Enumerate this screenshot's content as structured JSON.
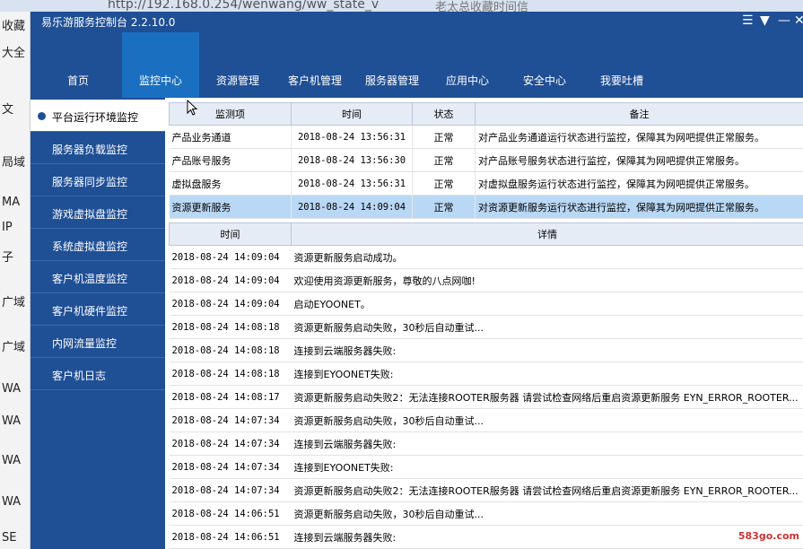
{
  "browser": {
    "url": "http://192.168.0.254/wenwang/ww_state_v",
    "tab_text": "老太总收藏时间信",
    "left_bits": [
      "收藏",
      "大全",
      "文",
      "局域",
      "MA",
      "IP",
      "子",
      "广域",
      "广域",
      "WA",
      "WA",
      "WA",
      "WA",
      "SE"
    ]
  },
  "window": {
    "title": "易乐游服务控制台 2.2.10.0",
    "controls": [
      "☰",
      "▼",
      "—",
      "✕"
    ]
  },
  "nav": [
    {
      "label": "首页",
      "icon": "home-icon"
    },
    {
      "label": "监控中心",
      "icon": "eye-icon"
    },
    {
      "label": "资源管理",
      "icon": "gamepad-icon"
    },
    {
      "label": "客户机管理",
      "icon": "monitor-icon"
    },
    {
      "label": "服务器管理",
      "icon": "server-icon"
    },
    {
      "label": "应用中心",
      "icon": "toolbox-icon"
    },
    {
      "label": "安全中心",
      "icon": "shield-icon"
    },
    {
      "label": "我要吐槽",
      "icon": "chat-icon"
    }
  ],
  "sidebar": [
    "平台运行环境监控",
    "服务器负载监控",
    "服务器同步监控",
    "游戏虚拟盘监控",
    "系统虚拟盘监控",
    "客户机温度监控",
    "客户机硬件监控",
    "内网流量监控",
    "客户机日志"
  ],
  "monitor_table": {
    "headers": [
      "监测项",
      "时间",
      "状态",
      "备注"
    ],
    "rows": [
      [
        "产品业务通道",
        "2018-08-24 13:56:31",
        "正常",
        "对产品业务通道运行状态进行监控，保障其为网吧提供正常服务。"
      ],
      [
        "产品账号服务",
        "2018-08-24 13:56:30",
        "正常",
        "对产品账号服务状态进行监控，保障其为网吧提供正常服务。"
      ],
      [
        "虚拟盘服务",
        "2018-08-24 13:56:31",
        "正常",
        "对虚拟盘服务运行状态进行监控，保障其为网吧提供正常服务。"
      ],
      [
        "资源更新服务",
        "2018-08-24 14:09:04",
        "正常",
        "对资源更新服务运行状态进行监控，保障其为网吧提供正常服务。"
      ]
    ]
  },
  "log_table": {
    "headers": [
      "时间",
      "详情"
    ],
    "rows": [
      [
        "2018-08-24 14:09:04",
        "资源更新服务启动成功。"
      ],
      [
        "2018-08-24 14:09:04",
        "欢迎使用资源更新服务，尊敬的八点网咖!"
      ],
      [
        "2018-08-24 14:09:04",
        "启动EYOONET。"
      ],
      [
        "2018-08-24 14:08:18",
        "资源更新服务启动失败，30秒后自动重试..."
      ],
      [
        "2018-08-24 14:08:18",
        "连接到云端服务器失败:"
      ],
      [
        "2018-08-24 14:08:18",
        "连接到EYOONET失败:"
      ],
      [
        "2018-08-24 14:08:17",
        "资源更新服务启动失败2：无法连接ROOTER服务器 请尝试检查网络后重启资源更新服务 EYN_ERROR_ROOTER..."
      ],
      [
        "2018-08-24 14:07:34",
        "资源更新服务启动失败，30秒后自动重试..."
      ],
      [
        "2018-08-24 14:07:34",
        "连接到云端服务器失败:"
      ],
      [
        "2018-08-24 14:07:34",
        "连接到EYOONET失败:"
      ],
      [
        "2018-08-24 14:07:34",
        "资源更新服务启动失败2：无法连接ROOTER服务器 请尝试检查网络后重启资源更新服务 EYN_ERROR_ROOTER..."
      ],
      [
        "2018-08-24 14:06:51",
        "资源更新服务启动失败，30秒后自动重试..."
      ],
      [
        "2018-08-24 14:06:51",
        "连接到云端服务器失败:"
      ]
    ]
  },
  "watermark": "583go.com",
  "colors": {
    "nav_bg": "#1f4f95",
    "nav_active": "#1a6fc1",
    "row_selected": "#b9d8f5"
  }
}
